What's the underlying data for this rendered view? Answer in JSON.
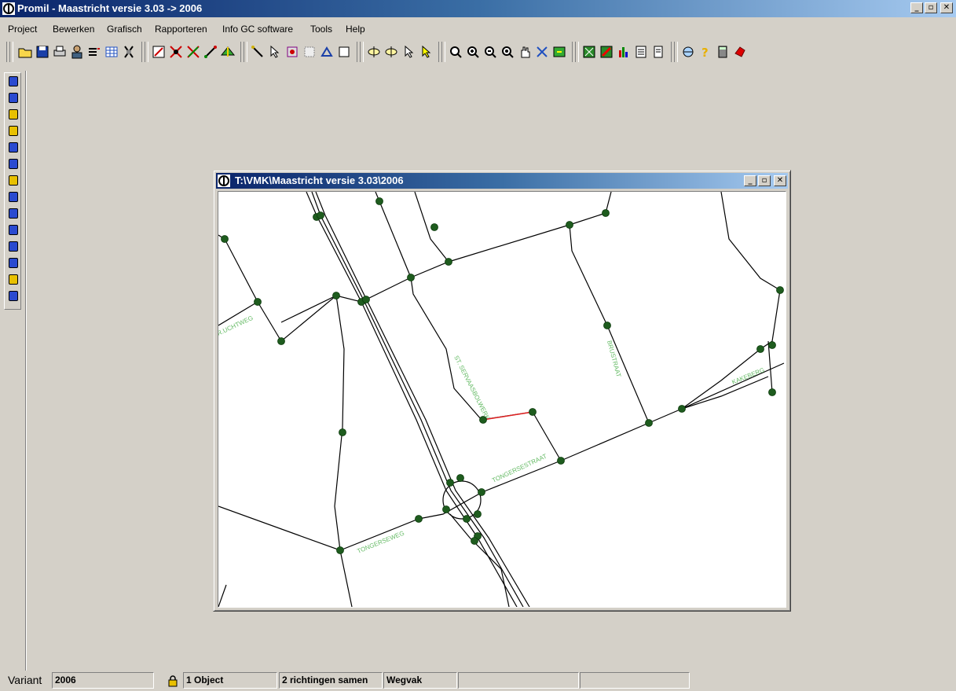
{
  "app": {
    "title": "Promil - Maastricht versie 3.03 -> 2006"
  },
  "window_buttons": {
    "minimize": "_",
    "restore": "▫",
    "close": "✕"
  },
  "menu": [
    "Project",
    "Bewerken",
    "Grafisch",
    "Rapporteren",
    "Info GC software",
    "Tools",
    "Help"
  ],
  "child_window": {
    "title": "T:\\VMK\\Maastricht versie 3.03\\2006"
  },
  "map": {
    "street_labels": [
      "R.UCHTWEG",
      "ST. SERVAASBOLWERK",
      "BRUSTRAAT",
      "KAKEBERG",
      "TONGERSESTRAAT",
      "TONGERSEWEG"
    ],
    "colors": {
      "road": "#000000",
      "node": "#1e5c1e",
      "label": "#66bb66",
      "selected": "#e02020"
    }
  },
  "status": {
    "variant_label": "Variant",
    "variant_value": "2006",
    "object": "1 Object",
    "direction": "2 richtingen samen",
    "type": "Wegvak",
    "field5": "",
    "field6": ""
  }
}
